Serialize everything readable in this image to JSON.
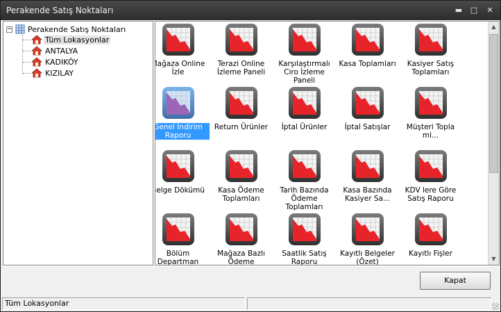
{
  "window": {
    "title": "Perakende Satış Noktaları"
  },
  "tree": {
    "root": "Perakende Satış Noktaları",
    "items": [
      {
        "label": "Tüm Lokasyonlar",
        "selected": true
      },
      {
        "label": "ANTALYA",
        "selected": false
      },
      {
        "label": "KADIKÖY",
        "selected": false
      },
      {
        "label": "KIZILAY",
        "selected": false
      }
    ]
  },
  "reports": [
    {
      "label": "Mağaza Online İzle",
      "icon": "report-chart-icon"
    },
    {
      "label": "Terazi Online İzleme Paneli",
      "icon": "report-chart-icon"
    },
    {
      "label": "Karşılaştırmalı Ciro İzleme Paneli",
      "icon": "report-chart-icon"
    },
    {
      "label": "Kasa Toplamları",
      "icon": "report-chart-icon"
    },
    {
      "label": "Kasiyer Satış Toplamları",
      "icon": "report-chart-icon"
    },
    {
      "label": "Genel İndirim Raporu",
      "icon": "report-chart-icon",
      "selected": true
    },
    {
      "label": "Return Ürünler",
      "icon": "report-chart-icon"
    },
    {
      "label": "İptal Ürünler",
      "icon": "report-chart-icon"
    },
    {
      "label": "İptal Satışlar",
      "icon": "report-chart-icon"
    },
    {
      "label": "Müşteri Topla ml...",
      "icon": "report-chart-icon"
    },
    {
      "label": "Belge Dökümü",
      "icon": "report-chart-icon"
    },
    {
      "label": "Kasa Ödeme Toplamları",
      "icon": "report-chart-icon"
    },
    {
      "label": "Tarih Bazında Ödeme Toplamları",
      "icon": "report-chart-icon"
    },
    {
      "label": "Kasa Bazında Kasiyer Sa...",
      "icon": "report-chart-icon"
    },
    {
      "label": "KDV lere Göre Satış Raporu",
      "icon": "report-chart-icon"
    },
    {
      "label": "Bölüm Departman Satışları",
      "icon": "report-chart-icon"
    },
    {
      "label": "Mağaza Bazlı Ödeme Toplamları",
      "icon": "report-chart-icon"
    },
    {
      "label": "Saatlik Satış Raporu",
      "icon": "report-chart-icon"
    },
    {
      "label": "Kayıtlı Belgeler (Özet)",
      "icon": "report-chart-icon"
    },
    {
      "label": "Kayıtlı Fişler",
      "icon": "report-chart-icon"
    }
  ],
  "buttons": {
    "close": "Kapat"
  },
  "status": {
    "left": "Tüm Lokasyonlar",
    "right": ""
  },
  "colors": {
    "titlebar": "#2c2c2c",
    "selection": "#3399ff",
    "chart_red": "#e8242b"
  }
}
